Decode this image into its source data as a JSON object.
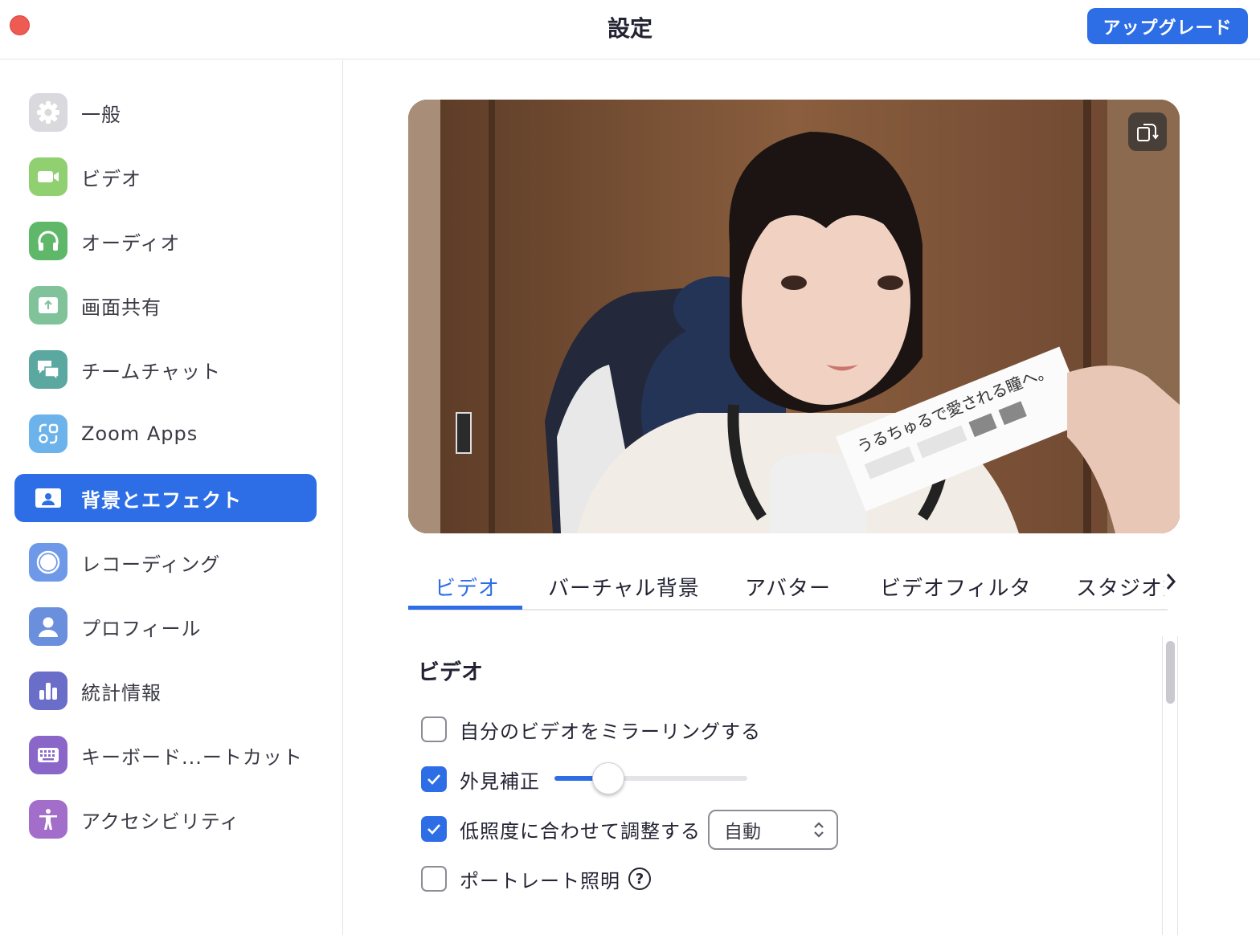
{
  "window": {
    "title": "設定",
    "upgrade_label": "アップグレード"
  },
  "sidebar": {
    "items": [
      {
        "label": "一般",
        "icon": "gear-icon",
        "color": "#d6d6db"
      },
      {
        "label": "ビデオ",
        "icon": "video-camera-icon",
        "color": "#8fd06e"
      },
      {
        "label": "オーディオ",
        "icon": "headphones-icon",
        "color": "#5fb86a"
      },
      {
        "label": "画面共有",
        "icon": "share-screen-icon",
        "color": "#7fc29a"
      },
      {
        "label": "チームチャット",
        "icon": "chat-bubbles-icon",
        "color": "#5aa8a0"
      },
      {
        "label": "Zoom Apps",
        "icon": "apps-icon",
        "color": "#6cb3ec"
      },
      {
        "label": "背景とエフェクト",
        "icon": "background-portrait-icon",
        "color": "#2d6ee6",
        "active": true
      },
      {
        "label": "レコーディング",
        "icon": "record-icon",
        "color": "#6e98e8"
      },
      {
        "label": "プロフィール",
        "icon": "profile-icon",
        "color": "#6a8fdc"
      },
      {
        "label": "統計情報",
        "icon": "statistics-icon",
        "color": "#6a6ec9"
      },
      {
        "label": "キーボード...ートカット",
        "icon": "keyboard-icon",
        "color": "#8b66c9"
      },
      {
        "label": "アクセシビリティ",
        "icon": "accessibility-icon",
        "color": "#a06ec9"
      }
    ]
  },
  "preview": {
    "rotate_icon": "rotate-camera-icon",
    "card_text": "うるちゅるで愛される瞳へ。"
  },
  "tabs": {
    "items": [
      "ビデオ",
      "バーチャル背景",
      "アバター",
      "ビデオフィルタ",
      "スタジオ効"
    ],
    "active_index": 0,
    "more_icon": "chevron-right-icon"
  },
  "video_section": {
    "title": "ビデオ",
    "mirror": {
      "label": "自分のビデオをミラーリングする",
      "checked": false
    },
    "touch_up": {
      "label": "外見補正",
      "checked": true,
      "slider_fraction": 0.28
    },
    "low_light": {
      "label": "低照度に合わせて調整する",
      "checked": true,
      "select_value": "自動"
    },
    "portrait_lighting": {
      "label": "ポートレート照明",
      "checked": false,
      "help": "?"
    }
  },
  "colors": {
    "accent": "#2d6ee6",
    "close": "#ee5b53"
  }
}
